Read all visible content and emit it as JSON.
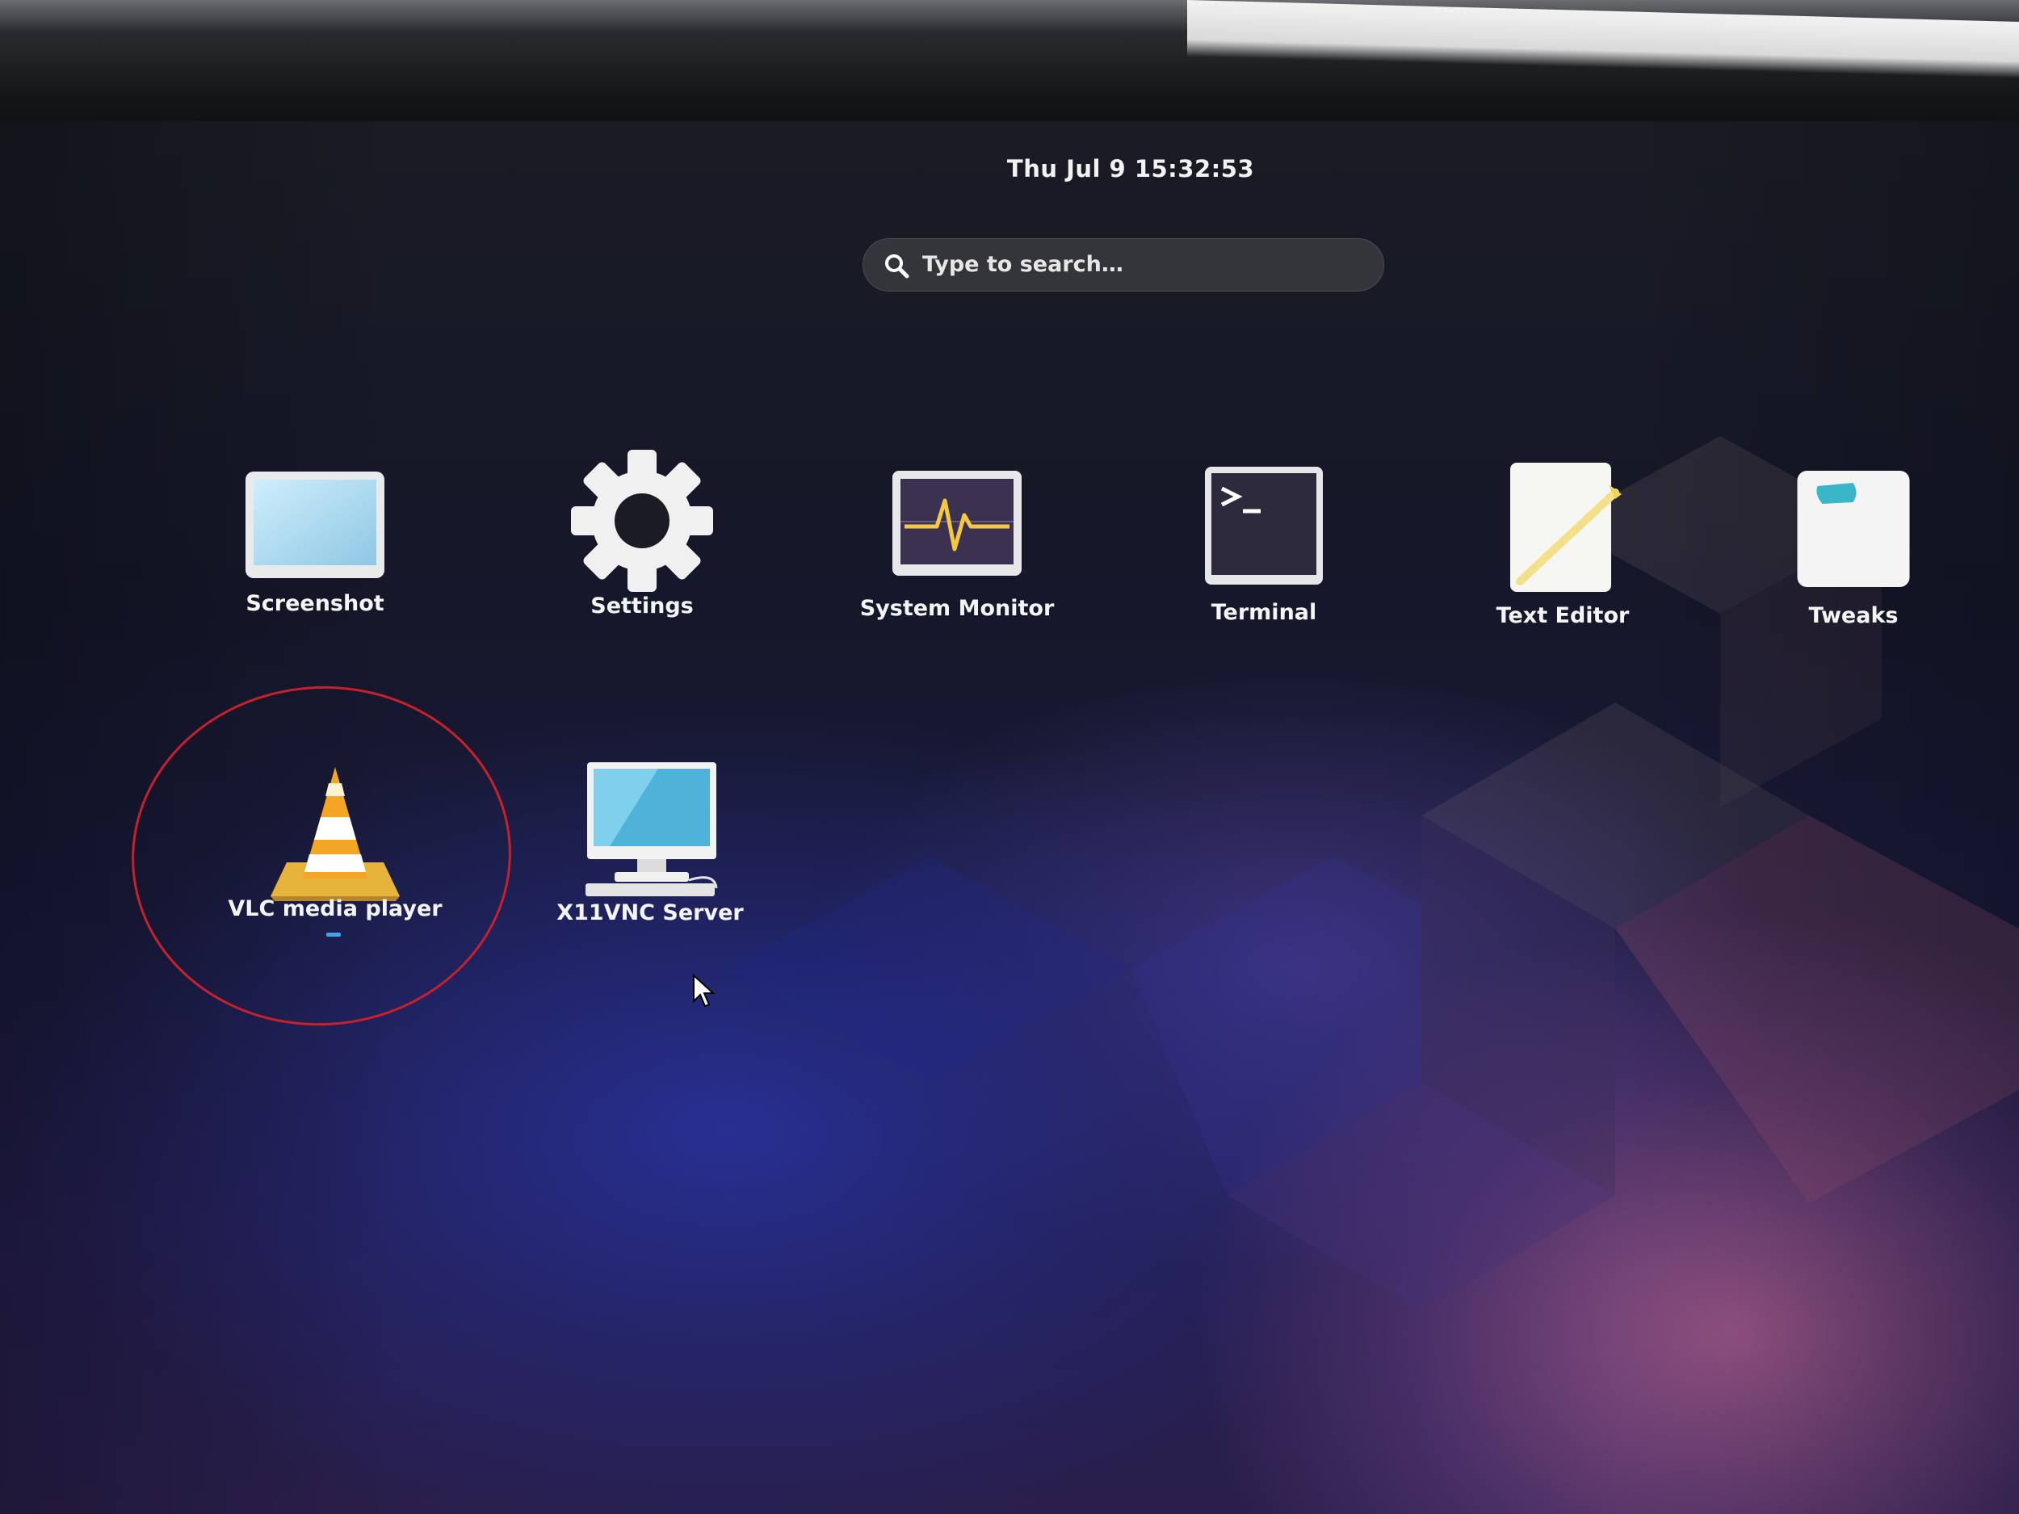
{
  "top_bar": {
    "clock": "Thu Jul 9  15:32:53"
  },
  "search": {
    "placeholder": "Type to search…",
    "icon": "search-icon"
  },
  "apps": [
    {
      "label": "Screenshot",
      "icon": "screenshot-icon"
    },
    {
      "label": "Settings",
      "icon": "gear-icon"
    },
    {
      "label": "System Monitor",
      "icon": "system-monitor-icon"
    },
    {
      "label": "Terminal",
      "icon": "terminal-icon"
    },
    {
      "label": "Text Editor",
      "icon": "text-editor-icon"
    },
    {
      "label": "Tweaks",
      "icon": "tweaks-icon"
    },
    {
      "label": "VLC media player",
      "icon": "vlc-cone-icon",
      "running": true
    },
    {
      "label": "X11VNC Server",
      "icon": "monitor-icon"
    }
  ],
  "annotation": {
    "highlight_color": "#c8202a",
    "highlighted_app": "VLC media player"
  },
  "colors": {
    "running_indicator": "#3fa4e8",
    "search_bg": "#34353a"
  }
}
